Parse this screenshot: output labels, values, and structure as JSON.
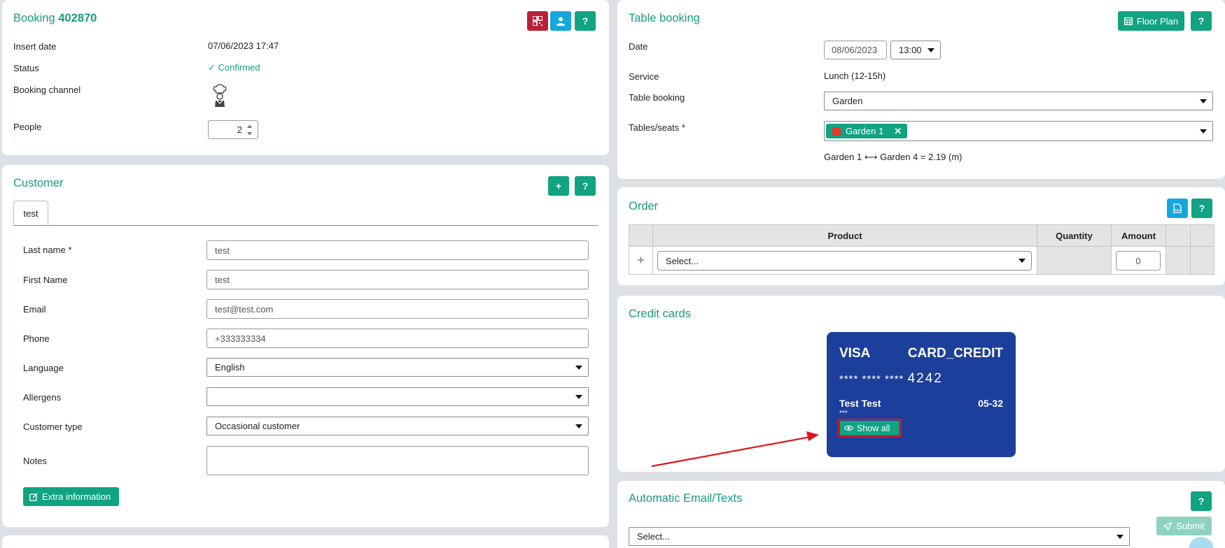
{
  "booking": {
    "title_prefix": "Booking",
    "number": "402870",
    "labels": {
      "insert_date": "Insert date",
      "status": "Status",
      "channel": "Booking channel",
      "people": "People"
    },
    "insert_date": "07/06/2023 17:47",
    "status": "Confirmed",
    "people": "2"
  },
  "customer": {
    "title": "Customer",
    "tab": "test",
    "fields": {
      "last_name": {
        "label": "Last name",
        "value": "test"
      },
      "first_name": {
        "label": "First Name",
        "value": "test"
      },
      "email": {
        "label": "Email",
        "value": "test@test.com"
      },
      "phone": {
        "label": "Phone",
        "value": "+333333334"
      },
      "language": {
        "label": "Language",
        "value": "English"
      },
      "allergens": {
        "label": "Allergens",
        "value": ""
      },
      "customer_type": {
        "label": "Customer type",
        "value": "Occasional customer"
      },
      "notes": {
        "label": "Notes",
        "value": ""
      }
    },
    "extra_button": "Extra information"
  },
  "table_booking": {
    "title": "Table booking",
    "floor_plan_button": "Floor Plan",
    "labels": {
      "date": "Date",
      "service": "Service",
      "table_booking": "Table booking",
      "tables_seats": "Tables/seats"
    },
    "date": "08/06/2023",
    "time": "13:00",
    "service": "Lunch (12-15h)",
    "area": "Garden",
    "table_tag": "Garden 1",
    "distance_from": "Garden 1",
    "distance_to": "Garden 4 = 2.19 (m)"
  },
  "order": {
    "title": "Order",
    "headers": {
      "product": "Product",
      "quantity": "Quantity",
      "amount": "Amount"
    },
    "product_placeholder": "Select...",
    "amount": "0"
  },
  "credit_cards": {
    "title": "Credit cards",
    "brand": "VISA",
    "type": "CARD_CREDIT",
    "masked": "**** **** ****",
    "last4": "4242",
    "holder": "Test Test",
    "cvc": "***",
    "expiry": "05-32",
    "show_all": "Show all"
  },
  "auto_email": {
    "title": "Automatic Email/Texts",
    "select_placeholder": "Select...",
    "submit": "Submit"
  },
  "colors": {
    "accent": "#1a9b80",
    "button_green": "#11a382",
    "button_blue": "#16a8dc",
    "button_red": "#b8213a",
    "card_blue": "#1c3f9b",
    "annotation_red": "#e0141b"
  },
  "icons": [
    "qr-icon",
    "user-icon",
    "help-icon",
    "check-icon",
    "chef-icon",
    "plus-icon",
    "calendar-icon",
    "close-icon",
    "pdf-icon",
    "eye-icon",
    "edit-icon",
    "send-icon"
  ]
}
